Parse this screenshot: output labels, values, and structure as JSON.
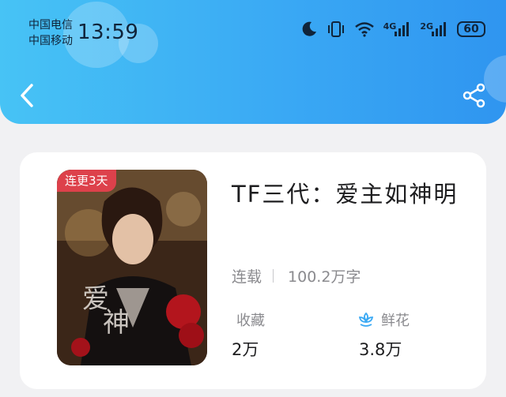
{
  "status_bar": {
    "carrier_1": "中国电信",
    "carrier_2": "中国移动",
    "time": "13:59",
    "net_4g": "4G",
    "net_2g": "2G",
    "battery": "60"
  },
  "header": {
    "back_icon": "chevron-left-icon",
    "share_icon": "share-icon",
    "color": "#3aa9f4"
  },
  "book": {
    "badge": "连更3天",
    "title": "TF三代：爱主如神明",
    "status": "连载",
    "word_count": "100.2万字",
    "favorites_label": "收藏",
    "favorites_value": "2万",
    "flowers_label": "鲜花",
    "flowers_value": "3.8万",
    "badge_color": "#e7404e",
    "flower_icon_color": "#3aa9f4"
  }
}
